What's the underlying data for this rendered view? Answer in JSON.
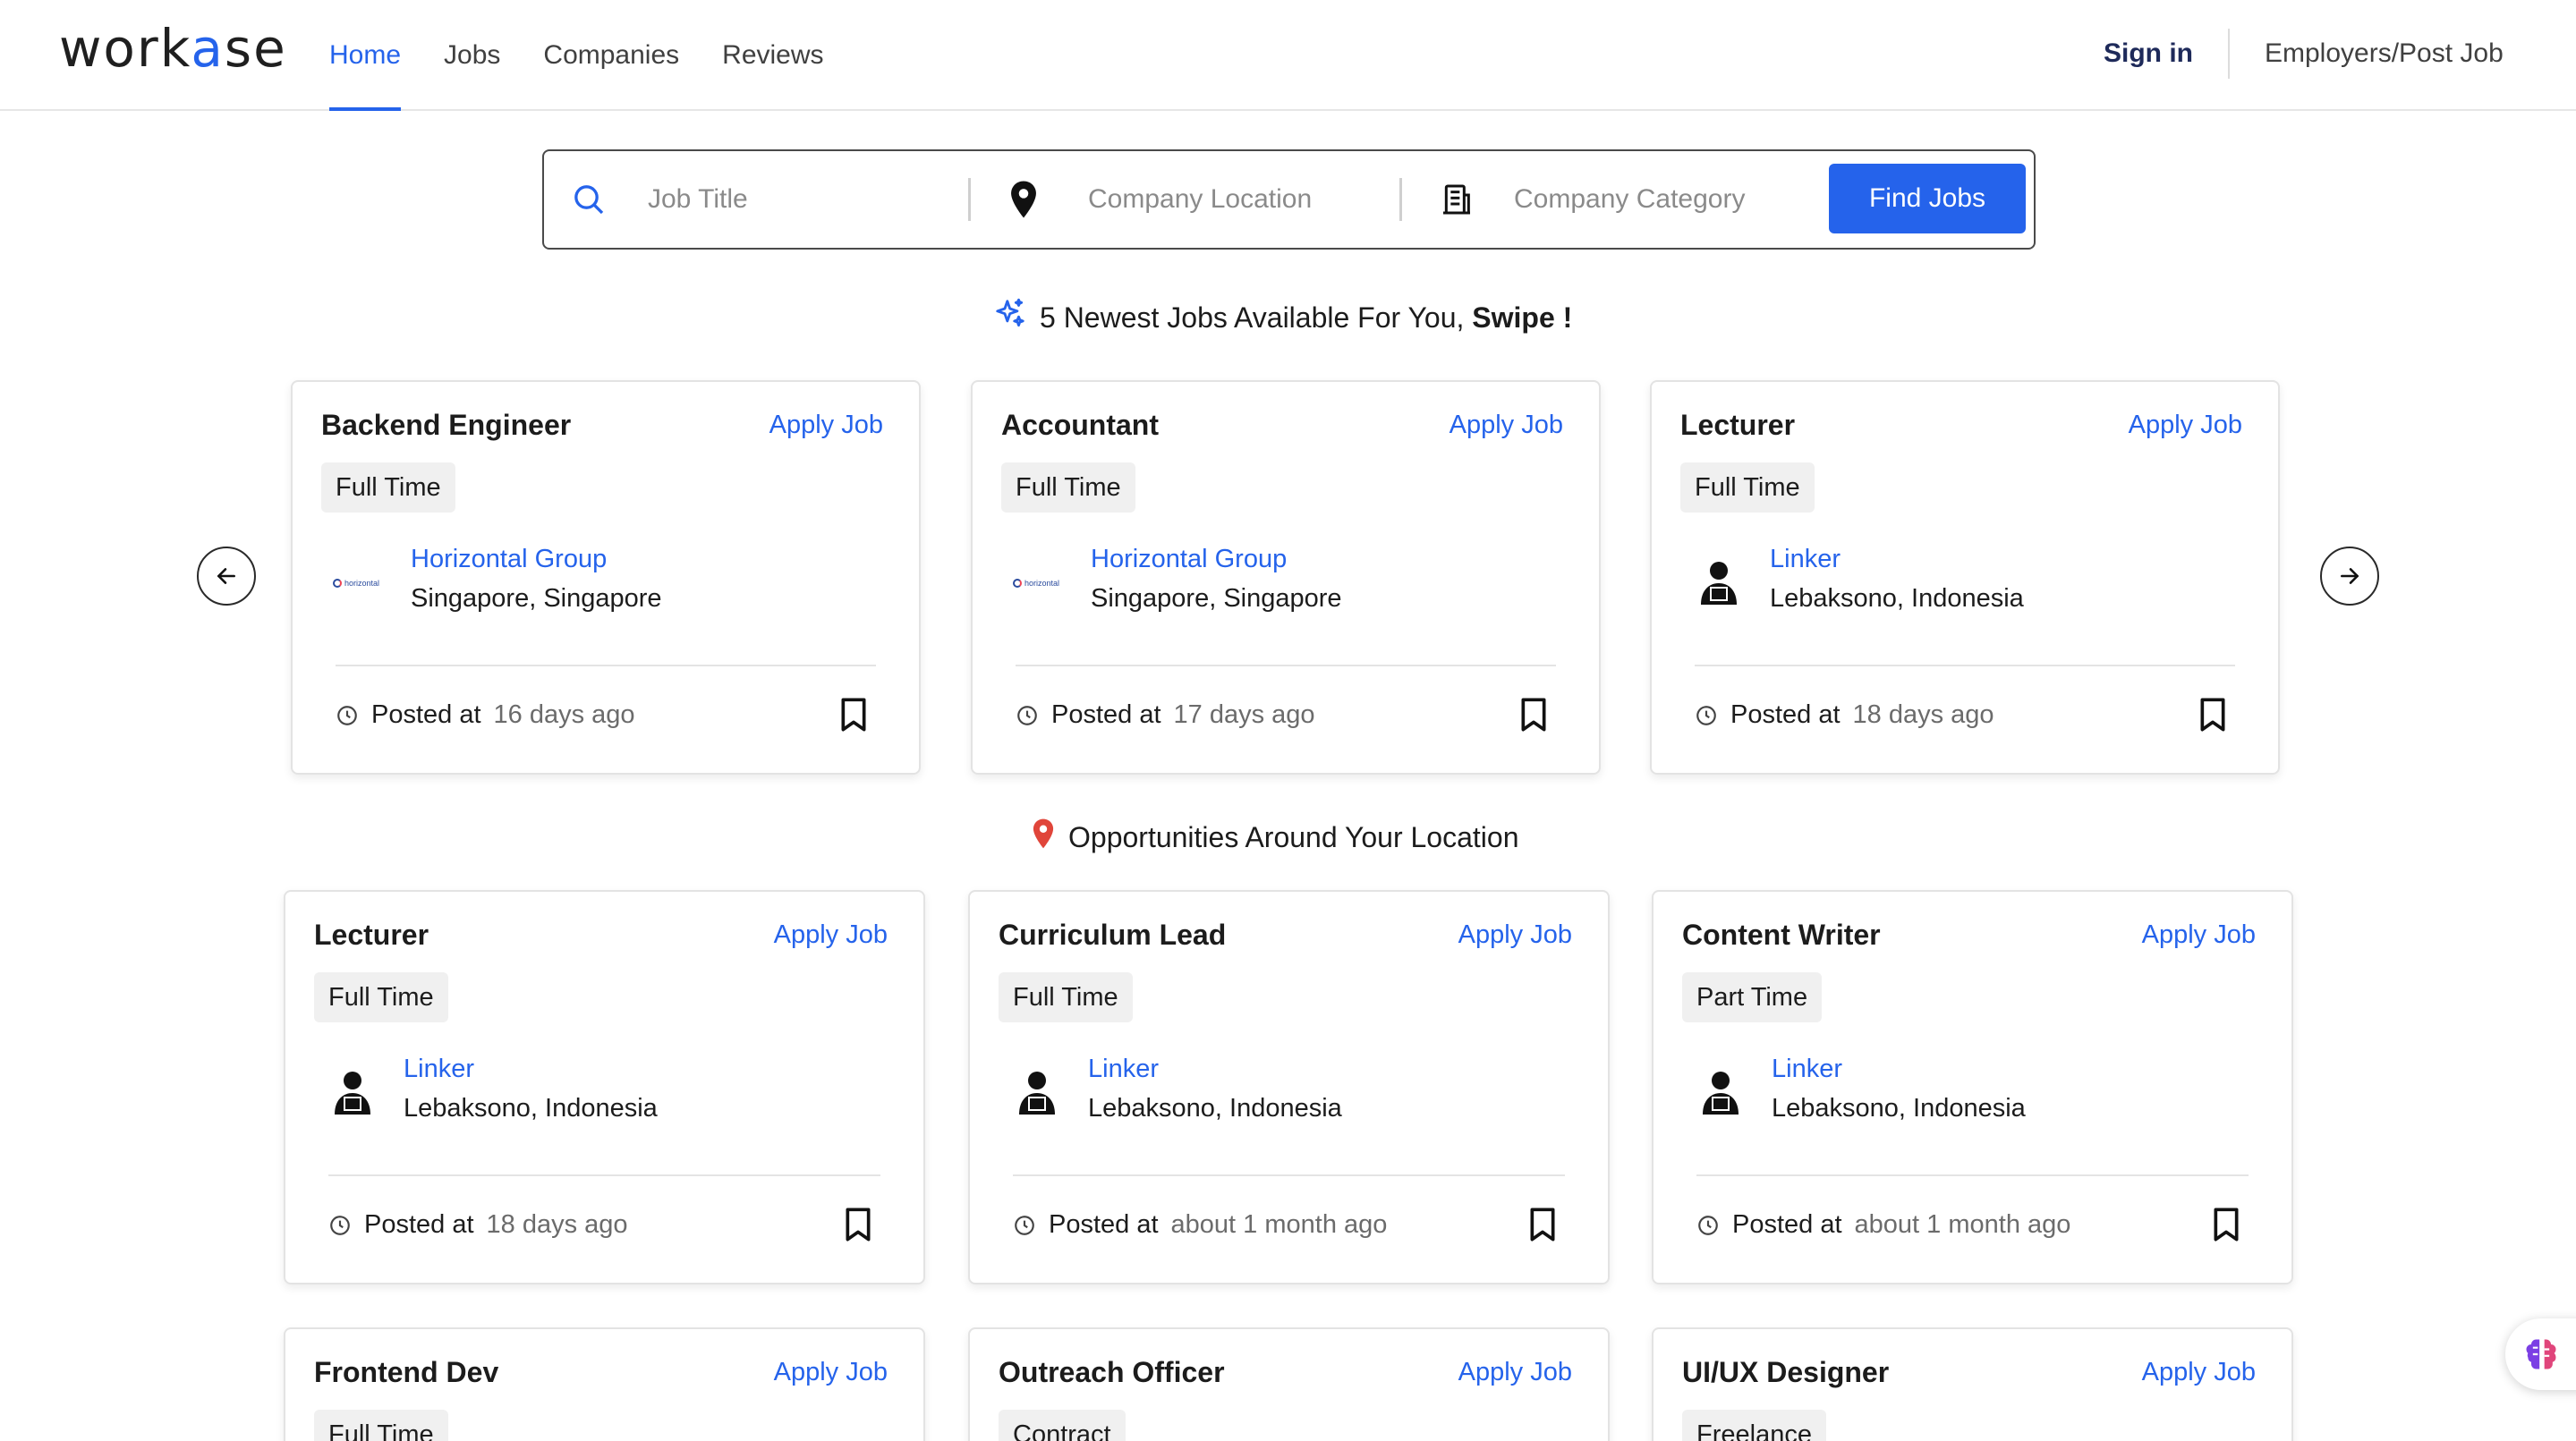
{
  "brand": {
    "logo_pre": "work",
    "logo_accent": "a",
    "logo_post": "se",
    "accent_color": "#2563eb"
  },
  "nav": {
    "items": [
      {
        "label": "Home",
        "active": true
      },
      {
        "label": "Jobs",
        "active": false
      },
      {
        "label": "Companies",
        "active": false
      },
      {
        "label": "Reviews",
        "active": false
      }
    ],
    "sign_in": "Sign in",
    "employers": "Employers/Post Job"
  },
  "search": {
    "job_title_placeholder": "Job Title",
    "location_placeholder": "Company Location",
    "category_placeholder": "Company Category",
    "button": "Find Jobs"
  },
  "newest": {
    "heading_pre": "5 Newest Jobs Available For You, ",
    "heading_bold": "Swipe !",
    "cards": [
      {
        "title": "Backend Engineer",
        "apply": "Apply Job",
        "type": "Full Time",
        "company": "Horizontal Group",
        "logo": "horizontal-logo",
        "location": "Singapore, Singapore",
        "posted_label": "Posted at",
        "posted_ago": "16 days ago"
      },
      {
        "title": "Accountant",
        "apply": "Apply Job",
        "type": "Full Time",
        "company": "Horizontal Group",
        "logo": "horizontal-logo",
        "location": "Singapore, Singapore",
        "posted_label": "Posted at",
        "posted_ago": "17 days ago"
      },
      {
        "title": "Lecturer",
        "apply": "Apply Job",
        "type": "Full Time",
        "company": "Linker",
        "logo": "person-icon",
        "location": "Lebaksono, Indonesia",
        "posted_label": "Posted at",
        "posted_ago": "18 days ago"
      }
    ]
  },
  "nearby": {
    "heading": "Opportunities Around Your Location",
    "cards": [
      {
        "title": "Lecturer",
        "apply": "Apply Job",
        "type": "Full Time",
        "company": "Linker",
        "logo": "person-icon",
        "location": "Lebaksono, Indonesia",
        "posted_label": "Posted at",
        "posted_ago": "18 days ago"
      },
      {
        "title": "Curriculum Lead",
        "apply": "Apply Job",
        "type": "Full Time",
        "company": "Linker",
        "logo": "person-icon",
        "location": "Lebaksono, Indonesia",
        "posted_label": "Posted at",
        "posted_ago": "about 1 month ago"
      },
      {
        "title": "Content Writer",
        "apply": "Apply Job",
        "type": "Part Time",
        "company": "Linker",
        "logo": "person-icon",
        "location": "Lebaksono, Indonesia",
        "posted_label": "Posted at",
        "posted_ago": "about 1 month ago"
      },
      {
        "title": "Frontend Dev",
        "apply": "Apply Job",
        "type": "Full Time"
      },
      {
        "title": "Outreach Officer",
        "apply": "Apply Job",
        "type": "Contract"
      },
      {
        "title": "UI/UX Designer",
        "apply": "Apply Job",
        "type": "Freelance"
      }
    ]
  },
  "horizontal_logo_text": "horizontal"
}
